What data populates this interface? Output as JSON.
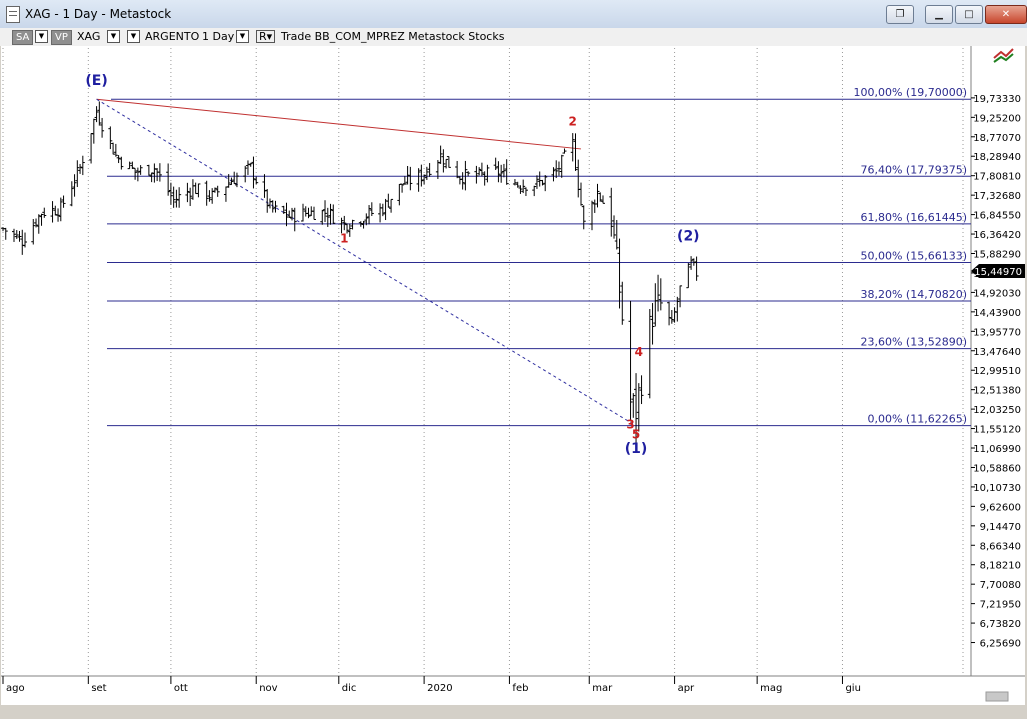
{
  "window": {
    "title": "XAG - 1 Day - Metastock",
    "buttons": [
      "restore",
      "minimize",
      "maximize",
      "close"
    ]
  },
  "toolbar": {
    "periodicity_button": "SA",
    "vp_button": "VP",
    "symbol": "XAG",
    "security_name": "ARGENTO",
    "timeframe": "1 Day",
    "r_button": "R",
    "source": "Trade  BB_COM_MPREZ  Metastock  Stocks"
  },
  "chart_data": {
    "type": "bar",
    "subtype": "ohlc",
    "symbol": "XAG",
    "x_labels": [
      "ago",
      "set",
      "ott",
      "nov",
      "dic",
      "2020",
      "feb",
      "mar",
      "apr",
      "mag",
      "giu"
    ],
    "y_labels": [
      "19,73330",
      "19,25200",
      "18,77070",
      "18,28940",
      "17,80810",
      "17,32680",
      "16,84550",
      "16,36420",
      "15,88290",
      "15,40160",
      "14,92030",
      "14,43900",
      "13,95770",
      "13,47640",
      "12,99510",
      "12,51380",
      "12,03250",
      "11,55120",
      "11,06990",
      "10,58860",
      "10,10730",
      "9,62600",
      "9,14470",
      "8,66340",
      "8,18210",
      "7,70080",
      "7,21950",
      "6,73820",
      "6,25690"
    ],
    "ylim": [
      5.8,
      20.25
    ],
    "last_price": "15,44970",
    "fibonacci_levels": [
      {
        "label": "100,00% (19,70000)",
        "value": 19.7
      },
      {
        "label": "76,40% (17,79375)",
        "value": 17.79375
      },
      {
        "label": "61,80% (16,61445)",
        "value": 16.61445
      },
      {
        "label": "50,00% (15,66133)",
        "value": 15.66133
      },
      {
        "label": "38,20% (14,70820)",
        "value": 14.7082
      },
      {
        "label": "23,60% (13,52890)",
        "value": 13.5289
      },
      {
        "label": "0,00% (11,62265)",
        "value": 11.62265
      }
    ],
    "wave_labels": [
      {
        "text": "(E)",
        "date": "2019-09-04",
        "value": 20.05,
        "color": "#1f1fa0"
      },
      {
        "text": "1",
        "date": "2019-12-03",
        "value": 16.15,
        "color": "#cc2020"
      },
      {
        "text": "2",
        "date": "2020-02-24",
        "value": 19.05,
        "color": "#cc2020"
      },
      {
        "text": "3",
        "date": "2020-03-16",
        "value": 11.55,
        "color": "#cc2020"
      },
      {
        "text": "4",
        "date": "2020-03-19",
        "value": 13.35,
        "color": "#cc2020"
      },
      {
        "text": "5",
        "date": "2020-03-18",
        "value": 11.3,
        "color": "#cc2020"
      },
      {
        "text": "(1)",
        "date": "2020-03-18",
        "value": 10.95,
        "color": "#1f1fa0"
      },
      {
        "text": "(2)",
        "date": "2020-04-06",
        "value": 16.2,
        "color": "#1f1fa0"
      }
    ],
    "trendlines": [
      {
        "from": {
          "date": "2019-09-04",
          "value": 19.7
        },
        "to": {
          "date": "2020-02-27",
          "value": 18.47
        },
        "color": "#c03030",
        "style": "solid"
      },
      {
        "from": {
          "date": "2019-09-04",
          "value": 19.7
        },
        "to": {
          "date": "2020-03-18",
          "value": 11.62
        },
        "color": "#3030a0",
        "style": "dashed"
      }
    ],
    "grid": "vertical-dotted",
    "price_path": [
      [
        "2019-08-01",
        16.5
      ],
      [
        "2019-08-08",
        16.2
      ],
      [
        "2019-08-15",
        16.9
      ],
      [
        "2019-08-22",
        17.0
      ],
      [
        "2019-08-29",
        18.0
      ],
      [
        "2019-09-04",
        19.4
      ],
      [
        "2019-09-11",
        18.3
      ],
      [
        "2019-09-18",
        17.9
      ],
      [
        "2019-09-25",
        18.0
      ],
      [
        "2019-10-02",
        17.2
      ],
      [
        "2019-10-09",
        17.5
      ],
      [
        "2019-10-16",
        17.3
      ],
      [
        "2019-10-23",
        17.7
      ],
      [
        "2019-10-30",
        18.0
      ],
      [
        "2019-11-06",
        17.0
      ],
      [
        "2019-11-13",
        16.8
      ],
      [
        "2019-11-20",
        16.9
      ],
      [
        "2019-11-27",
        16.9
      ],
      [
        "2019-12-03",
        16.6
      ],
      [
        "2019-12-10",
        16.8
      ],
      [
        "2019-12-17",
        17.0
      ],
      [
        "2019-12-24",
        17.6
      ],
      [
        "2019-12-31",
        17.8
      ],
      [
        "2020-01-07",
        18.3
      ],
      [
        "2020-01-14",
        17.8
      ],
      [
        "2020-01-21",
        17.8
      ],
      [
        "2020-01-28",
        17.9
      ],
      [
        "2020-02-04",
        17.6
      ],
      [
        "2020-02-11",
        17.6
      ],
      [
        "2020-02-18",
        17.9
      ],
      [
        "2020-02-24",
        18.6
      ],
      [
        "2020-02-28",
        16.6
      ],
      [
        "2020-03-04",
        17.4
      ],
      [
        "2020-03-09",
        16.8
      ],
      [
        "2020-03-12",
        15.0
      ],
      [
        "2020-03-16",
        12.2
      ],
      [
        "2020-03-18",
        12.0
      ],
      [
        "2020-03-20",
        12.8
      ],
      [
        "2020-03-24",
        14.4
      ],
      [
        "2020-03-27",
        14.6
      ],
      [
        "2020-03-31",
        14.1
      ],
      [
        "2020-04-03",
        15.0
      ],
      [
        "2020-04-07",
        15.6
      ],
      [
        "2020-04-09",
        15.4
      ]
    ]
  }
}
